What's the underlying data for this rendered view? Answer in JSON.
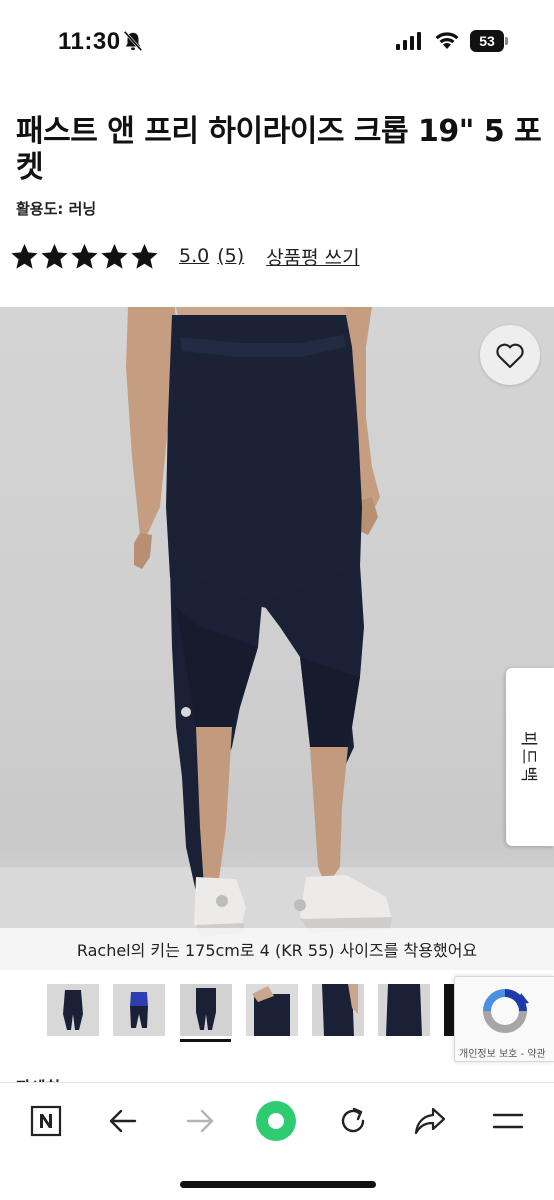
{
  "status_bar": {
    "time": "11:30",
    "battery_level": "53",
    "icons": [
      "bell-slash-icon",
      "signal-icon",
      "wifi-icon",
      "battery-icon"
    ]
  },
  "product": {
    "title": "패스트 앤 프리 하이라이즈 크롭 19\" 5 포켓",
    "activity": "활용도: 러닝",
    "rating": {
      "stars": 5,
      "score": "5.0",
      "count": "(5)",
      "write_review": "상품평 쓰기"
    }
  },
  "image": {
    "caption": "Rachel의 키는 175cm로 4 (KR 55) 사이즈를 착용했어요",
    "favorite_icon": "heart-outline-icon"
  },
  "feedback_tab": {
    "label": "피드백"
  },
  "thumbnails": {
    "count": 7,
    "selected_index": 2
  },
  "recaptcha": {
    "text": "개인정보 보호 - 약관"
  },
  "section_peek": {
    "label": "자세히"
  },
  "toolbar": {
    "icons": [
      "naver-home-icon",
      "back-arrow-icon",
      "forward-arrow-icon",
      "green-circle-icon",
      "refresh-icon",
      "share-icon",
      "menu-icon"
    ]
  },
  "colors": {
    "accent_green": "#2ecc71",
    "legging_navy": "#1a2136",
    "star": "#111111"
  }
}
